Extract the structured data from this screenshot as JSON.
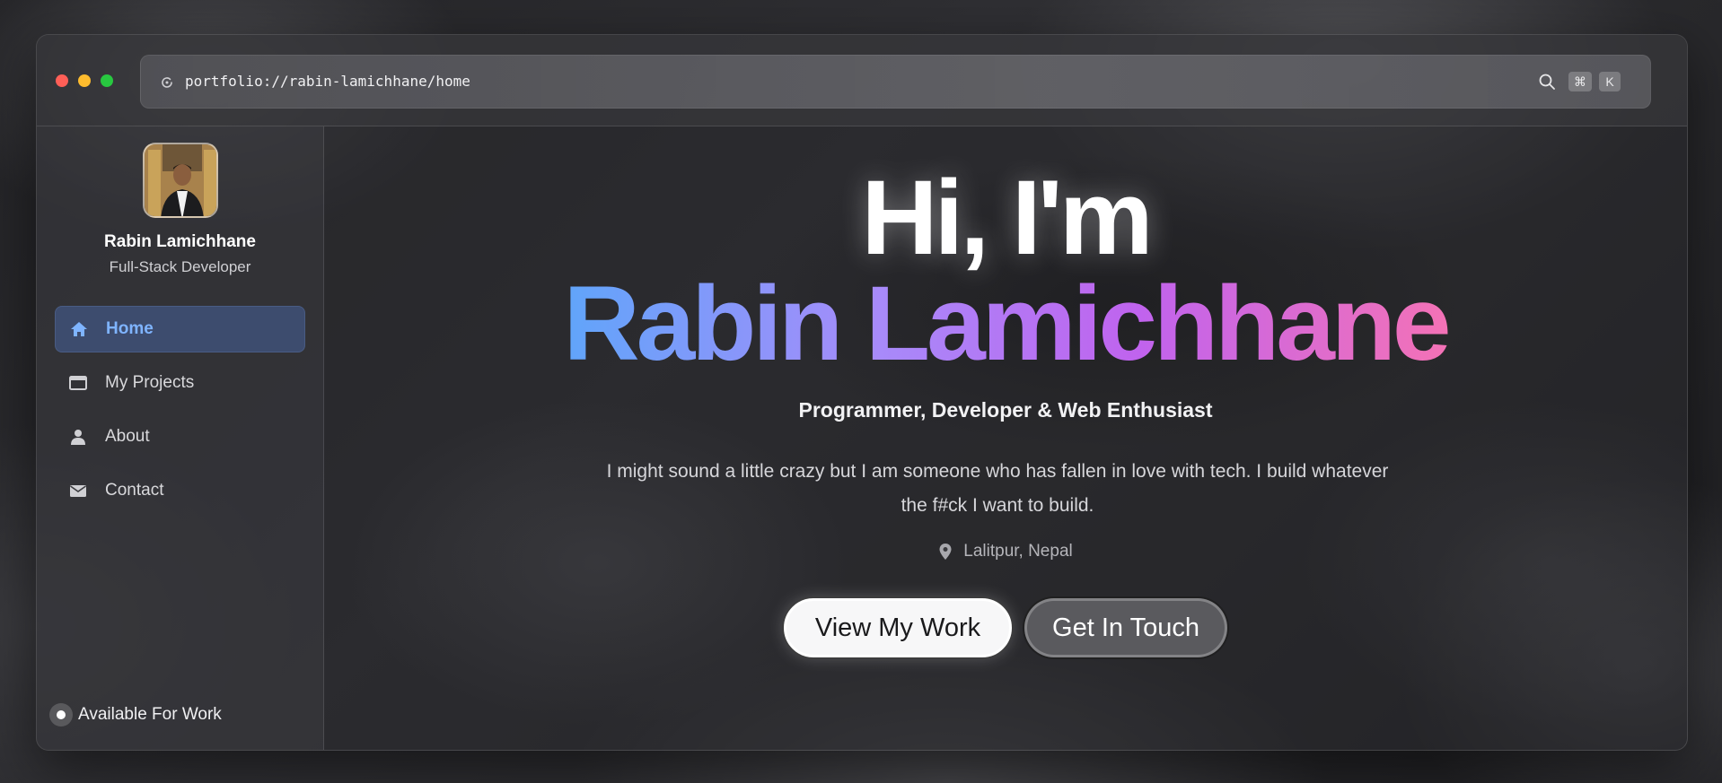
{
  "browser": {
    "url": "portfolio://rabin-lamichhane/home",
    "shortcut_keys": [
      "⌘",
      "K"
    ]
  },
  "sidebar": {
    "profile": {
      "name": "Rabin Lamichhane",
      "role": "Full-Stack Developer"
    },
    "items": [
      {
        "label": "Home",
        "icon": "home-icon",
        "active": true
      },
      {
        "label": "My Projects",
        "icon": "window-icon",
        "active": false
      },
      {
        "label": "About",
        "icon": "person-icon",
        "active": false
      },
      {
        "label": "Contact",
        "icon": "mail-icon",
        "active": false
      }
    ],
    "status": "Available For Work"
  },
  "hero": {
    "greeting": "Hi, I'm",
    "name": "Rabin Lamichhane",
    "tagline": "Programmer, Developer & Web Enthusiast",
    "description": "I might sound a little crazy but I am someone who has fallen in love with tech. I build whatever the f#ck I want to build.",
    "location": "Lalitpur, Nepal",
    "primary_button": "View My Work",
    "secondary_button": "Get In Touch"
  },
  "colors": {
    "accent": "#7fb4ff",
    "gradient": [
      "#60a5fa",
      "#a78bfa",
      "#c063ee",
      "#f472b6"
    ]
  }
}
